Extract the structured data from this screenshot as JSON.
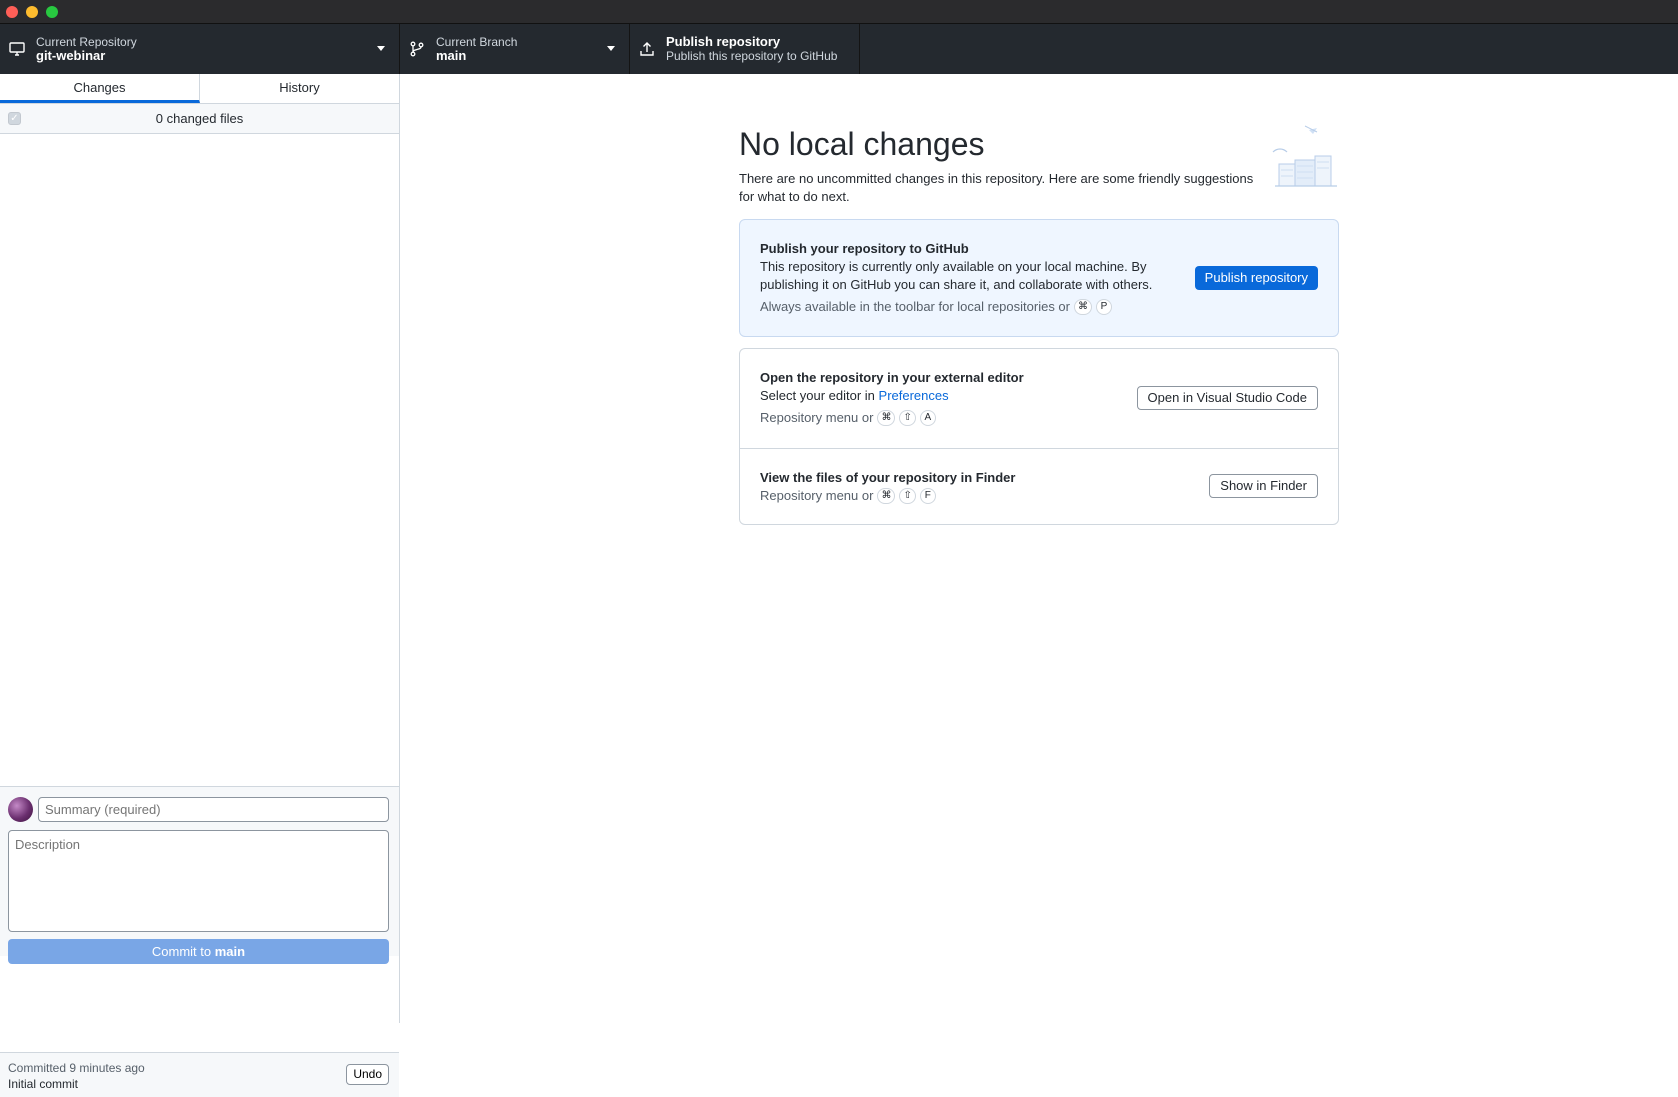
{
  "window": {
    "controls": [
      "close",
      "minimize",
      "maximize"
    ]
  },
  "toolbar": {
    "repository": {
      "label": "Current Repository",
      "value": "git-webinar",
      "icon": "computer-icon"
    },
    "branch": {
      "label": "Current Branch",
      "value": "main",
      "icon": "branch-icon"
    },
    "publish": {
      "title": "Publish repository",
      "subtitle": "Publish this repository to GitHub",
      "icon": "upload-icon"
    }
  },
  "sidebar": {
    "tabs": [
      {
        "label": "Changes",
        "active": true
      },
      {
        "label": "History",
        "active": false
      }
    ],
    "changed_files": "0 changed files"
  },
  "commit": {
    "summary_placeholder": "Summary (required)",
    "description_placeholder": "Description",
    "button_prefix": "Commit to",
    "button_branch": "main"
  },
  "last_commit": {
    "when": "Committed 9 minutes ago",
    "message": "Initial commit",
    "undo_label": "Undo"
  },
  "blank_slate": {
    "title": "No local changes",
    "subtitle": "There are no uncommitted changes in this repository. Here are some friendly suggestions for what to do next."
  },
  "cards": {
    "publish": {
      "title": "Publish your repository to GitHub",
      "description": "This repository is currently only available on your local machine. By publishing it on GitHub you can share it, and collaborate with others.",
      "hint": "Always available in the toolbar for local repositories or",
      "shortcut": [
        "⌘",
        "P"
      ],
      "button": "Publish repository"
    },
    "editor": {
      "title": "Open the repository in your external editor",
      "description_prefix": "Select your editor in",
      "description_link": "Preferences",
      "hint": "Repository menu or",
      "shortcut": [
        "⌘",
        "⇧",
        "A"
      ],
      "button": "Open in Visual Studio Code"
    },
    "finder": {
      "title": "View the files of your repository in Finder",
      "hint": "Repository menu or",
      "shortcut": [
        "⌘",
        "⇧",
        "F"
      ],
      "button": "Show in Finder"
    }
  },
  "colors": {
    "accent": "#0969da",
    "toolbar_bg": "#24292f",
    "publish_card_bg": "#eff6ff",
    "commit_button_disabled": "#79a6e6"
  }
}
